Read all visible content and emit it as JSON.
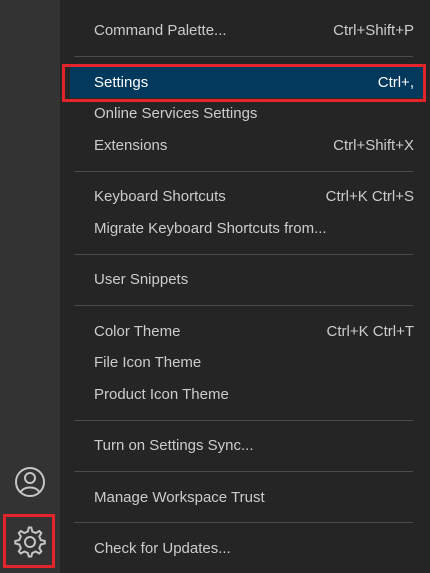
{
  "activity_bar": {
    "icons": [
      "accounts-icon",
      "gear-icon"
    ],
    "highlight_color": "#e3242b"
  },
  "menu": {
    "items": [
      {
        "label": "Command Palette...",
        "shortcut": "Ctrl+Shift+P"
      },
      {
        "label": "Settings",
        "shortcut": "Ctrl+,",
        "selected": true
      },
      {
        "label": "Online Services Settings",
        "shortcut": ""
      },
      {
        "label": "Extensions",
        "shortcut": "Ctrl+Shift+X"
      },
      {
        "label": "Keyboard Shortcuts",
        "shortcut": "Ctrl+K Ctrl+S"
      },
      {
        "label": "Migrate Keyboard Shortcuts from...",
        "shortcut": ""
      },
      {
        "label": "User Snippets",
        "shortcut": ""
      },
      {
        "label": "Color Theme",
        "shortcut": "Ctrl+K Ctrl+T"
      },
      {
        "label": "File Icon Theme",
        "shortcut": ""
      },
      {
        "label": "Product Icon Theme",
        "shortcut": ""
      },
      {
        "label": "Turn on Settings Sync...",
        "shortcut": ""
      },
      {
        "label": "Manage Workspace Trust",
        "shortcut": ""
      },
      {
        "label": "Check for Updates...",
        "shortcut": ""
      }
    ],
    "selected_background": "#04395e",
    "text_color": "#cccccc"
  }
}
